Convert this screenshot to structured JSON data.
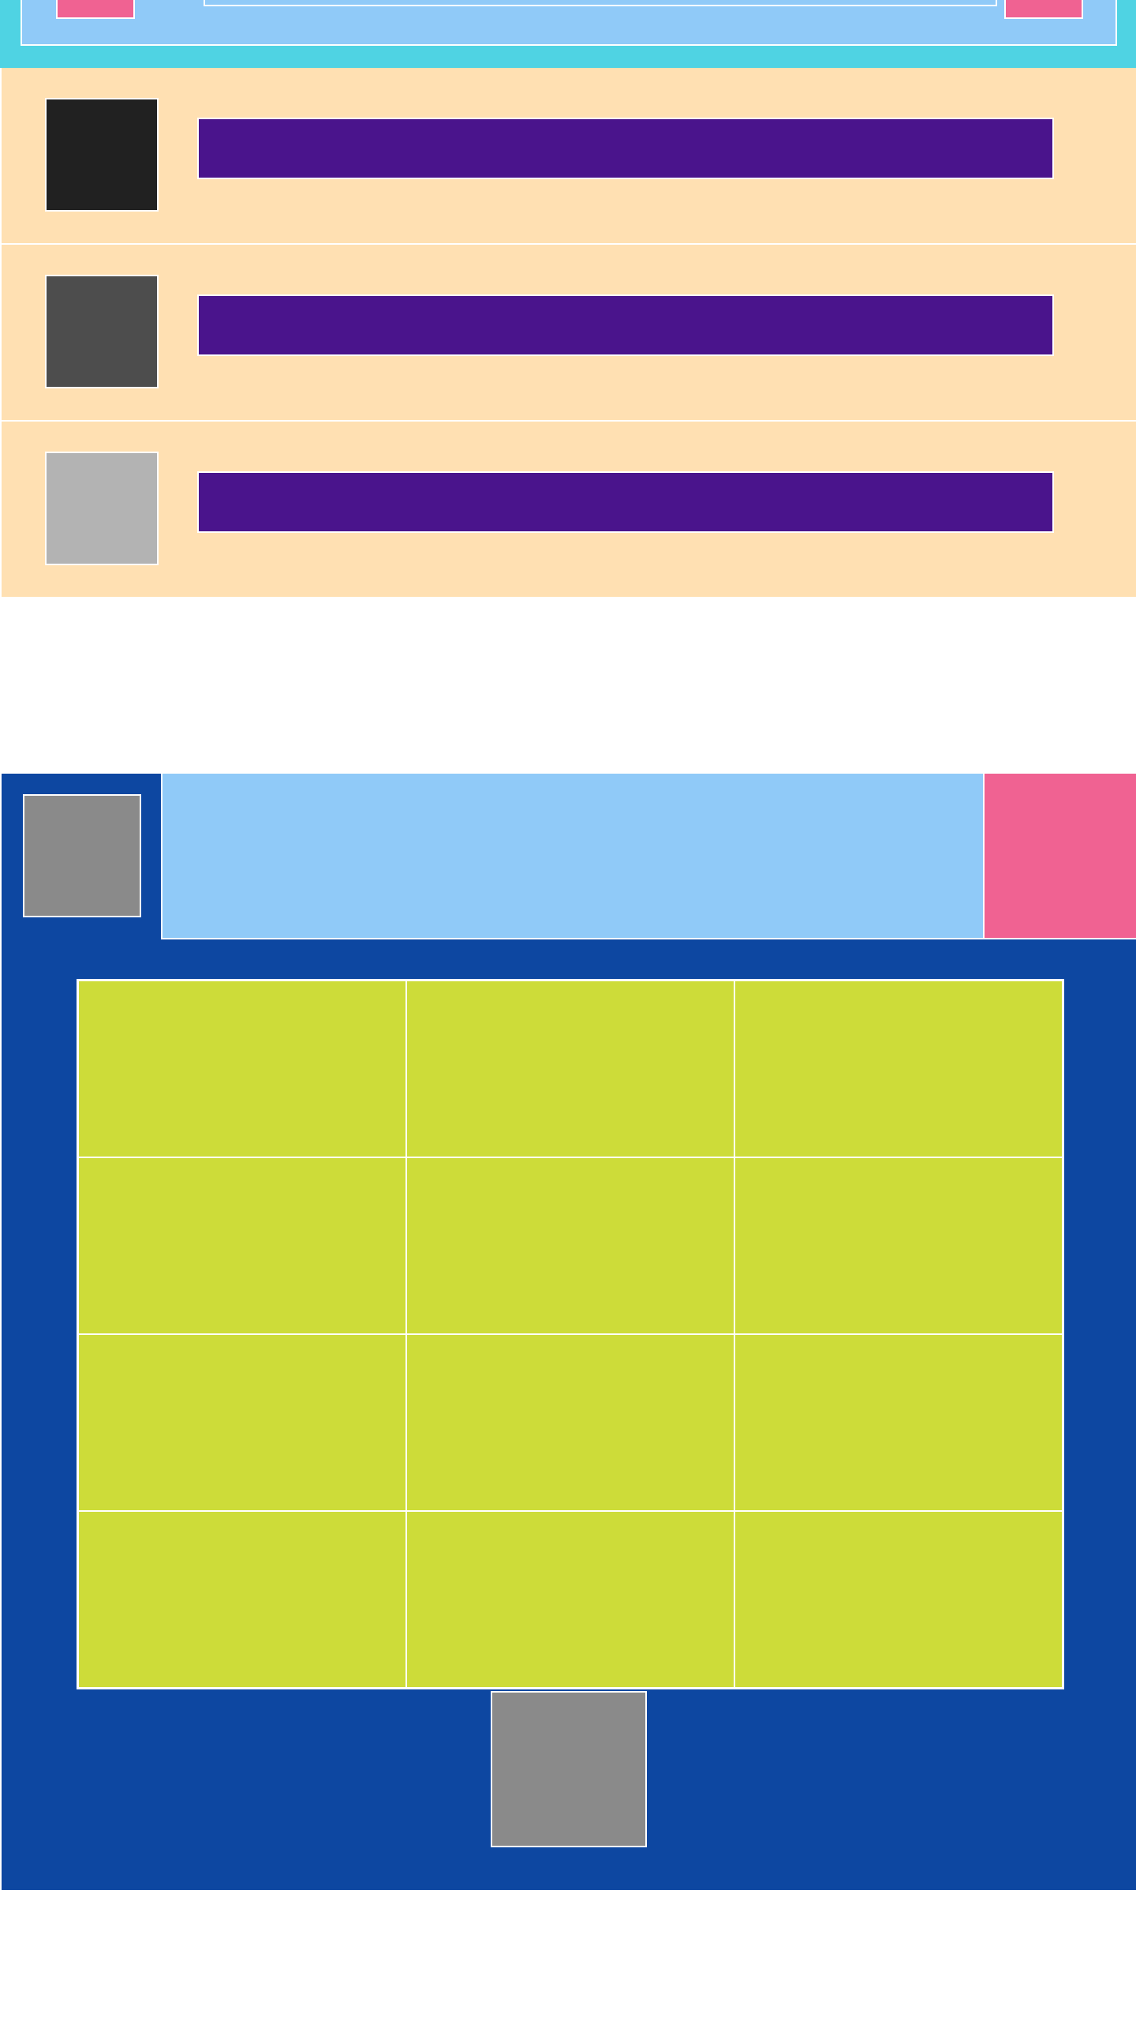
{
  "colors": {
    "top_bar_bg": "#4fd3e3",
    "top_bar_inner": "#90caf8",
    "accent_pink": "#f06292",
    "list_bg": "#ffe0b2",
    "list_bar": "#4a148c",
    "thumb_1": "#212121",
    "thumb_2": "#4d4d4d",
    "thumb_3": "#b3b3b3",
    "panel_bg": "#0d47a1",
    "panel_header": "#90caf8",
    "panel_avatar": "#8a8a8a",
    "grid_cell": "#cddc39",
    "bottom_button": "#8a8a8a"
  },
  "top_bar": {
    "left_button_label": "",
    "right_button_label": "",
    "field_value": ""
  },
  "list": {
    "items": [
      {
        "label": ""
      },
      {
        "label": ""
      },
      {
        "label": ""
      }
    ]
  },
  "panel": {
    "header_text": "",
    "action_label": "",
    "grid_cells": [
      "",
      "",
      "",
      "",
      "",
      "",
      "",
      "",
      "",
      "",
      "",
      ""
    ],
    "bottom_button_label": ""
  }
}
